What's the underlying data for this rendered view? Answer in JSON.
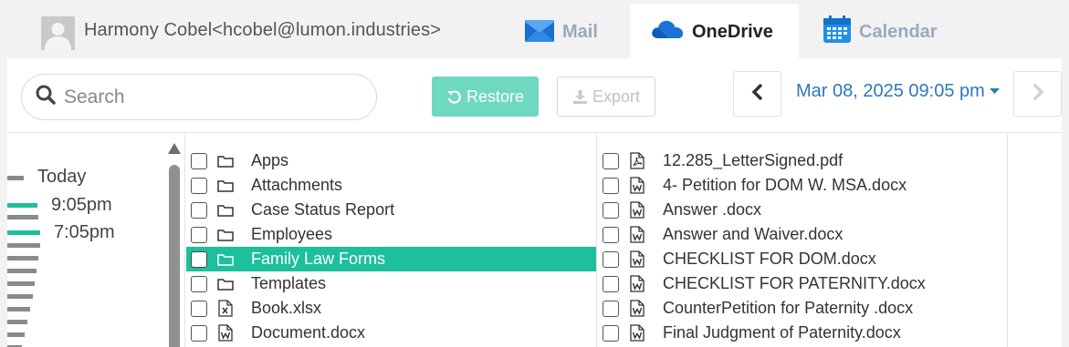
{
  "header": {
    "user_label": "Harmony Cobel<hcobel@lumon.industries>",
    "tabs": [
      {
        "label": "Mail",
        "icon": "mail-icon",
        "active": false
      },
      {
        "label": "OneDrive",
        "icon": "onedrive-icon",
        "active": true
      },
      {
        "label": "Calendar",
        "icon": "calendar-icon",
        "active": false
      }
    ]
  },
  "toolbar": {
    "search_placeholder": "Search",
    "restore_label": "Restore",
    "export_label": "Export",
    "date_value": "Mar 08, 2025 09:05 pm"
  },
  "timeline": {
    "day_label": "Today",
    "entries": [
      {
        "time": "9:05pm",
        "selected": true
      },
      {
        "time": "7:05pm",
        "selected": false
      }
    ]
  },
  "folders": [
    {
      "name": "Apps",
      "type": "folder",
      "selected": false
    },
    {
      "name": "Attachments",
      "type": "folder",
      "selected": false
    },
    {
      "name": "Case Status Report",
      "type": "folder",
      "selected": false
    },
    {
      "name": "Employees",
      "type": "folder",
      "selected": false
    },
    {
      "name": "Family Law Forms",
      "type": "folder",
      "selected": true
    },
    {
      "name": "Templates",
      "type": "folder",
      "selected": false
    },
    {
      "name": "Book.xlsx",
      "type": "excel",
      "selected": false
    },
    {
      "name": "Document.docx",
      "type": "word",
      "selected": false
    }
  ],
  "files": [
    {
      "name": "12.285_LetterSigned.pdf",
      "type": "pdf"
    },
    {
      "name": "4- Petition for DOM W. MSA.docx",
      "type": "word"
    },
    {
      "name": "Answer .docx",
      "type": "word"
    },
    {
      "name": "Answer and Waiver.docx",
      "type": "word"
    },
    {
      "name": "CHECKLIST FOR DOM.docx",
      "type": "word"
    },
    {
      "name": "CHECKLIST FOR PATERNITY.docx",
      "type": "word"
    },
    {
      "name": "CounterPetition for Paternity .docx",
      "type": "word"
    },
    {
      "name": "Final Judgment of Paternity.docx",
      "type": "word"
    }
  ],
  "colors": {
    "accent_teal": "#1ebf9c",
    "restore_button": "#6fd8c0",
    "date_link": "#2e78b7",
    "inactive_tab": "#9aa9bd"
  }
}
